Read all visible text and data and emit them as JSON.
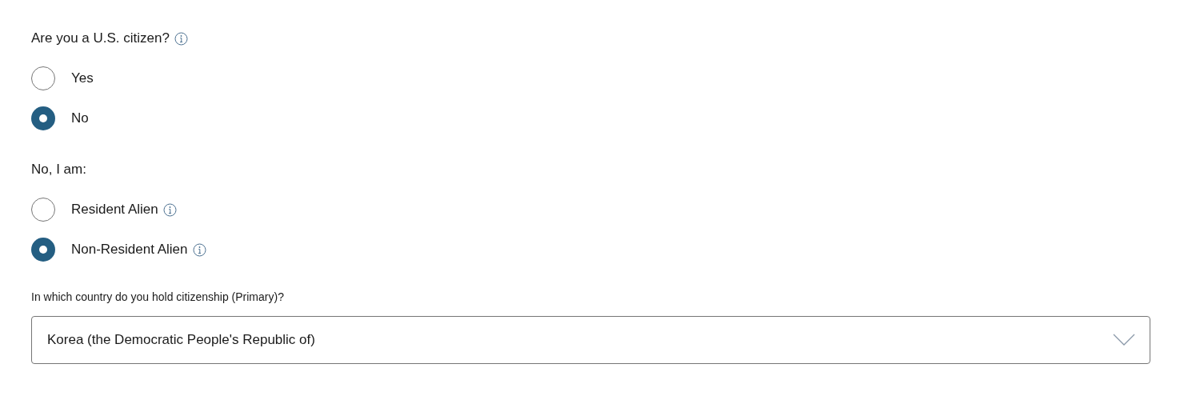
{
  "citizen_question": {
    "label": "Are you a U.S. citizen?",
    "has_info": true,
    "options": [
      {
        "label": "Yes",
        "selected": false,
        "has_info": false
      },
      {
        "label": "No",
        "selected": true,
        "has_info": false
      }
    ]
  },
  "status_question": {
    "label": "No, I am:",
    "has_info": false,
    "options": [
      {
        "label": "Resident Alien",
        "selected": false,
        "has_info": true
      },
      {
        "label": "Non-Resident Alien",
        "selected": true,
        "has_info": true
      }
    ]
  },
  "country": {
    "label": "In which country do you hold citizenship (Primary)?",
    "value": "Korea (the Democratic People's Republic of)"
  }
}
